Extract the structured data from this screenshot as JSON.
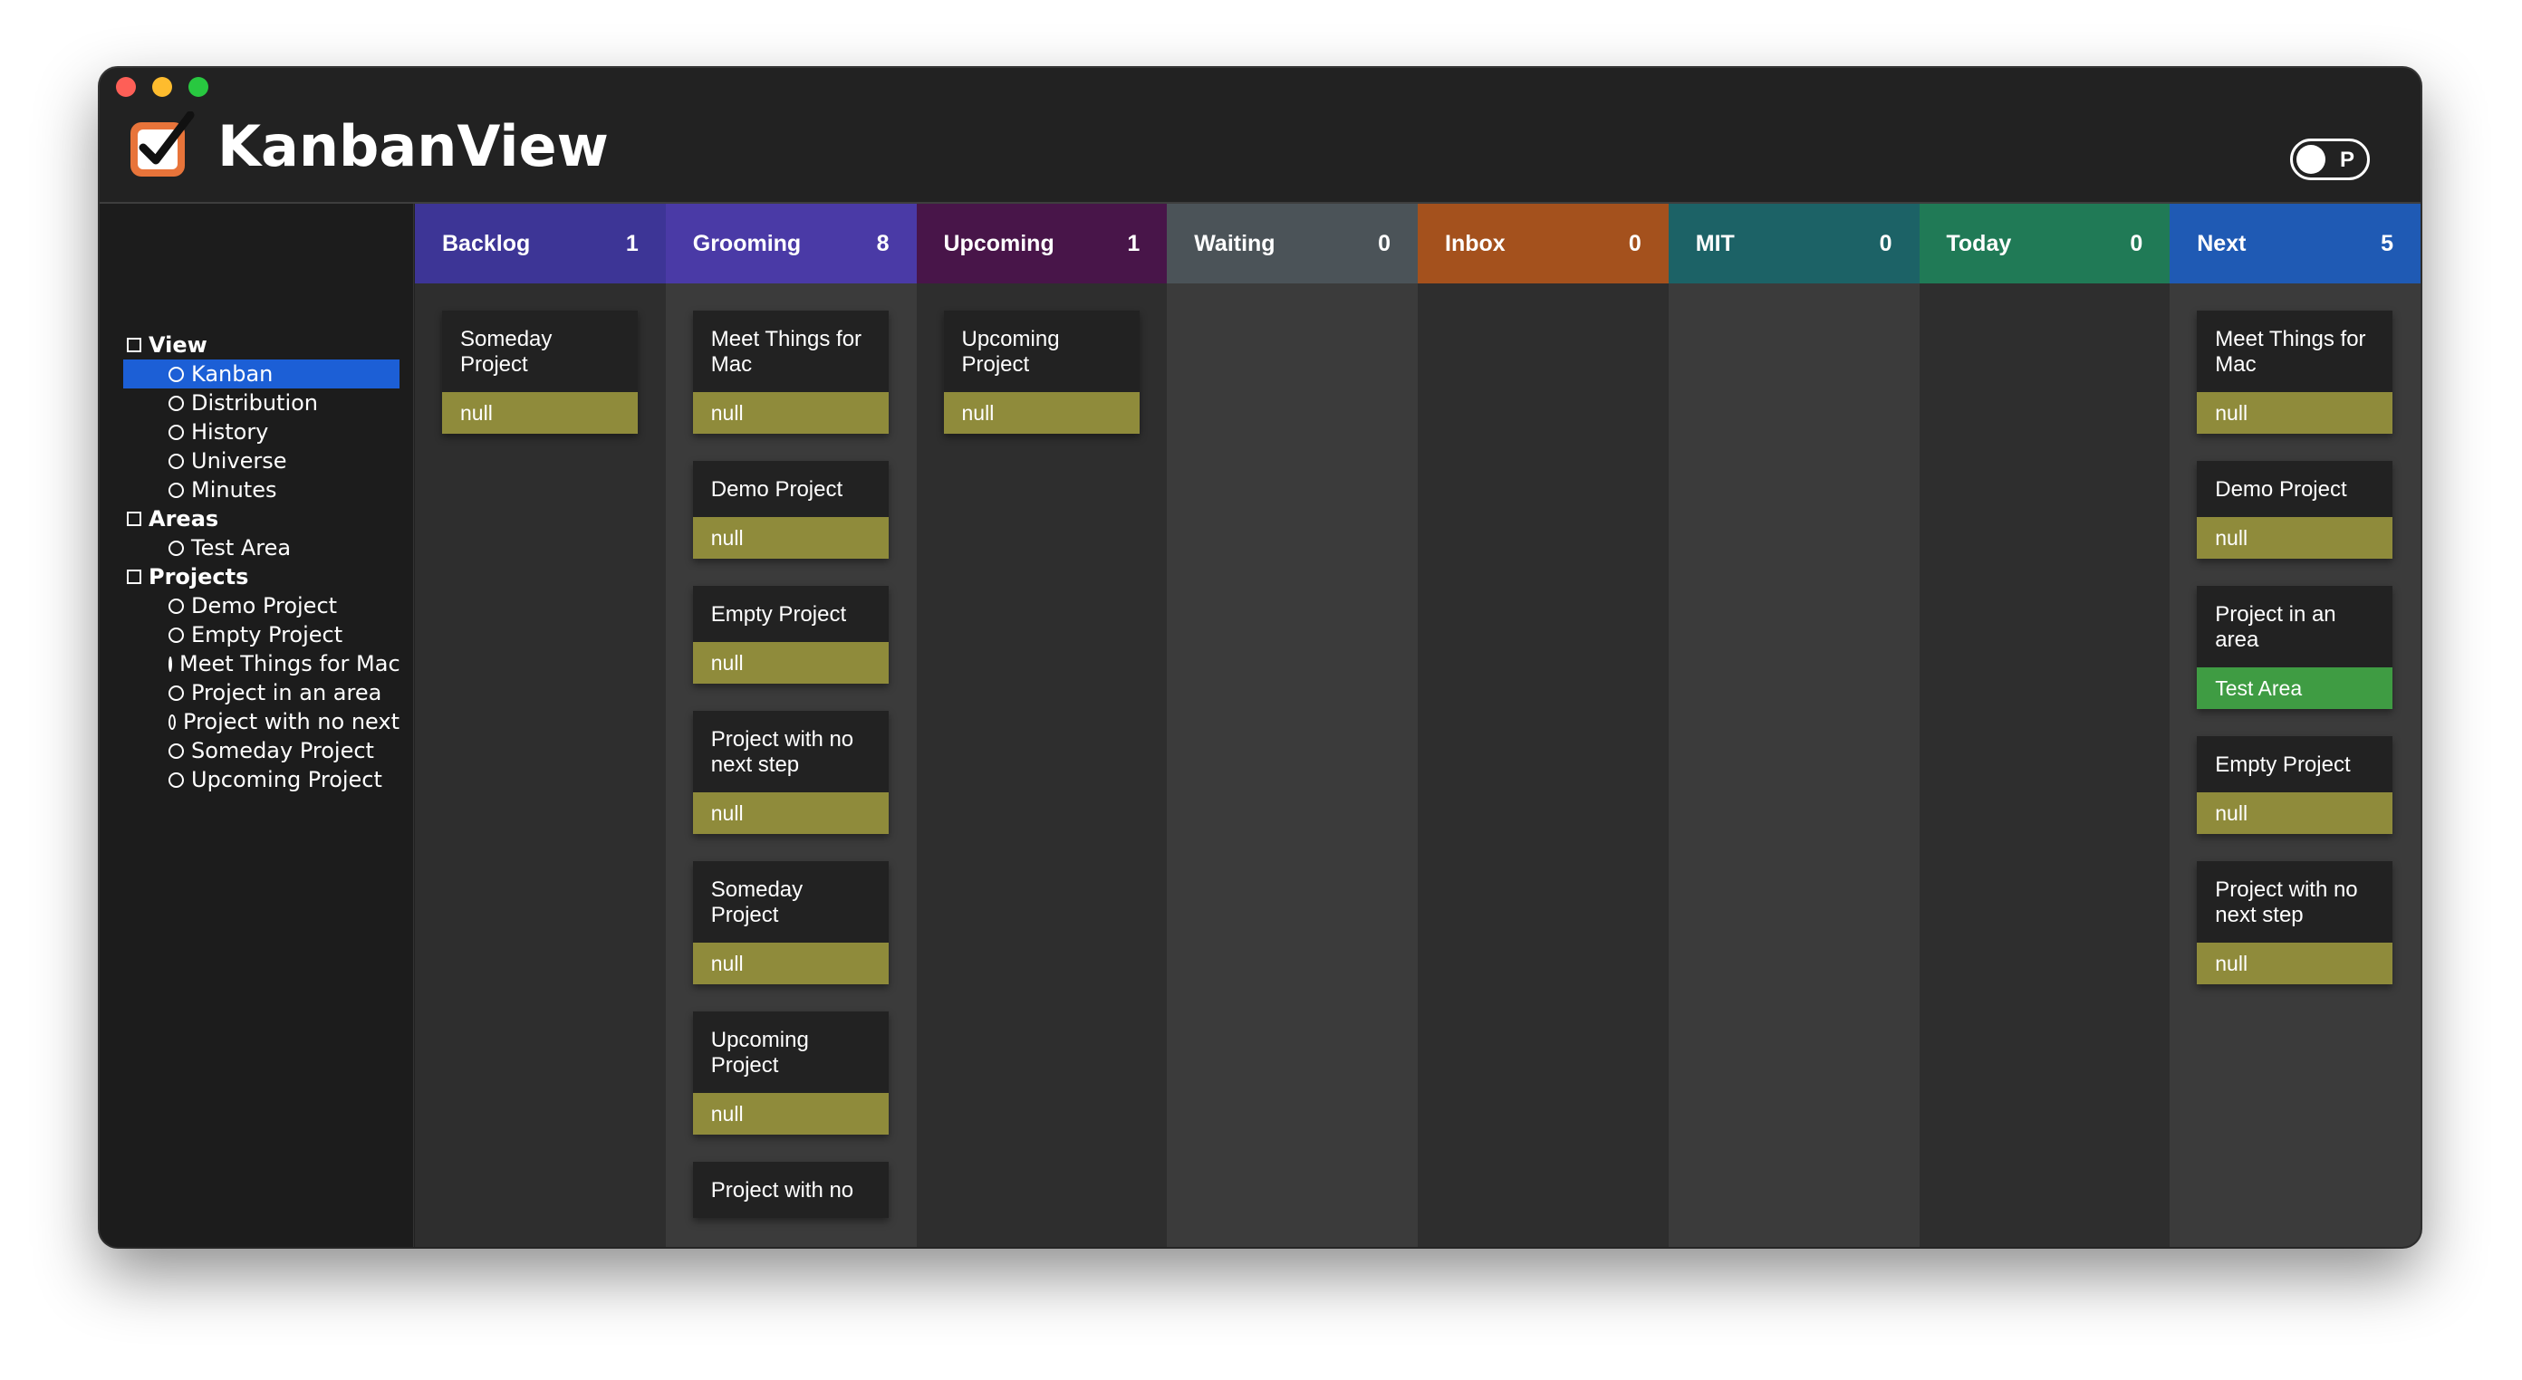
{
  "app": {
    "title": "KanbanView",
    "toggle_label": "P"
  },
  "sidebar": {
    "groups": [
      {
        "label": "View",
        "items": [
          "Kanban",
          "Distribution",
          "History",
          "Universe",
          "Minutes"
        ]
      },
      {
        "label": "Areas",
        "items": [
          "Test Area"
        ]
      },
      {
        "label": "Projects",
        "items": [
          "Demo Project",
          "Empty Project",
          "Meet Things for Mac",
          "Project in an area",
          "Project with no next",
          "Someday Project",
          "Upcoming Project"
        ]
      }
    ],
    "selected": "Kanban"
  },
  "columns": [
    {
      "name": "Backlog",
      "count": "1",
      "color": "#3d3596",
      "body": "#2e2e2e",
      "cards": [
        {
          "title": "Someday Project",
          "tag": "null"
        }
      ]
    },
    {
      "name": "Grooming",
      "count": "8",
      "color": "#4a3aa6",
      "body": "#3b3b3b",
      "cards": [
        {
          "title": "Meet Things for Mac",
          "tag": "null"
        },
        {
          "title": "Demo Project",
          "tag": "null"
        },
        {
          "title": "Empty Project",
          "tag": "null"
        },
        {
          "title": "Project with no next step",
          "tag": "null"
        },
        {
          "title": "Someday Project",
          "tag": "null"
        },
        {
          "title": "Upcoming Project",
          "tag": "null"
        },
        {
          "title": "Project with no",
          "tag": ""
        }
      ]
    },
    {
      "name": "Upcoming",
      "count": "1",
      "color": "#481549",
      "body": "#2e2e2e",
      "cards": [
        {
          "title": "Upcoming Project",
          "tag": "null"
        }
      ]
    },
    {
      "name": "Waiting",
      "count": "0",
      "color": "#4b5358",
      "body": "#3b3b3b",
      "cards": []
    },
    {
      "name": "Inbox",
      "count": "0",
      "color": "#a4511d",
      "body": "#2e2e2e",
      "cards": []
    },
    {
      "name": "MIT",
      "count": "0",
      "color": "#1c6266",
      "body": "#3b3b3b",
      "cards": []
    },
    {
      "name": "Today",
      "count": "0",
      "color": "#207a56",
      "body": "#2e2e2e",
      "cards": []
    },
    {
      "name": "Next",
      "count": "5",
      "color": "#1f5ab4",
      "body": "#3b3b3b",
      "cards": [
        {
          "title": "Meet Things for Mac",
          "tag": "null"
        },
        {
          "title": "Demo Project",
          "tag": "null"
        },
        {
          "title": "Project in an area",
          "tag": "Test Area",
          "tag_type": "area"
        },
        {
          "title": "Empty Project",
          "tag": "null"
        },
        {
          "title": "Project with no next step",
          "tag": "null"
        }
      ]
    }
  ],
  "colors": {
    "tag_null": "#8f8b3b",
    "tag_area": "#3f9c43",
    "selection": "#1c5fd6"
  }
}
